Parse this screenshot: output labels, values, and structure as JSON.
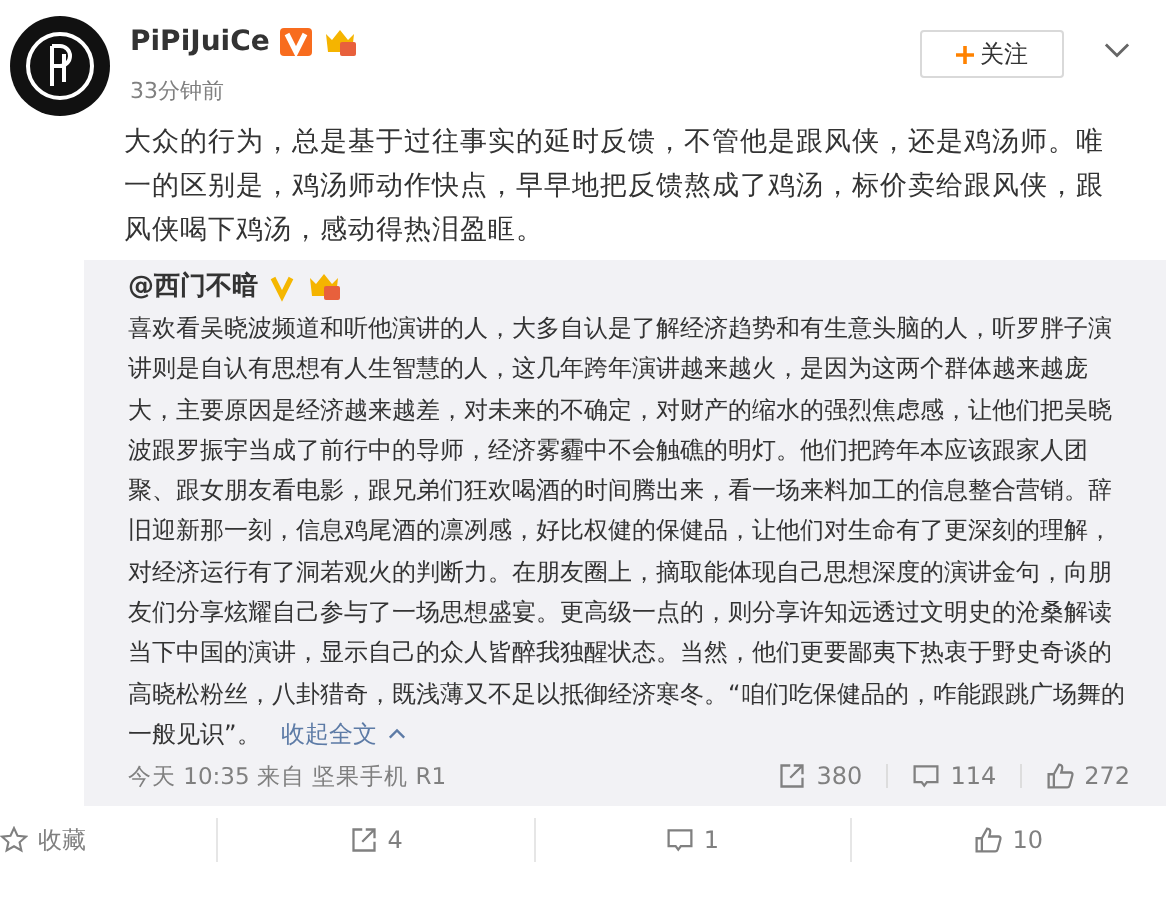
{
  "post": {
    "author": "PiPiJuiCe",
    "verified": true,
    "time": "33分钟前",
    "follow_button": "关注",
    "text": "大众的行为，总是基于过往事实的延时反馈，不管他是跟风侠，还是鸡汤师。唯一的区别是，鸡汤师动作快点，早早地把反馈熬成了鸡汤，标价卖给跟风侠，跟风侠喝下鸡汤，感动得热泪盈眶。"
  },
  "repost": {
    "author": "@西门不暗",
    "verified": true,
    "text": "喜欢看吴晓波频道和听他演讲的人，大多自认是了解经济趋势和有生意头脑的人，听罗胖子演讲则是自认有思想有人生智慧的人，这几年跨年演讲越来越火，是因为这两个群体越来越庞大，主要原因是经济越来越差，对未来的不确定，对财产的缩水的强烈焦虑感，让他们把吴晓波跟罗振宇当成了前行中的导师，经济雾霾中不会触礁的明灯。他们把跨年本应该跟家人团聚、跟女朋友看电影，跟兄弟们狂欢喝酒的时间腾出来，看一场来料加工的信息整合营销。辞旧迎新那一刻，信息鸡尾酒的凛冽感，好比权健的保健品，让他们对生命有了更深刻的理解，对经济运行有了洞若观火的判断力。在朋友圈上，摘取能体现自己思想深度的演讲金句，向朋友们分享炫耀自己参与了一场思想盛宴。更高级一点的，则分享许知远透过文明史的沧桑解读当下中国的演讲，显示自己的众人皆醉我独醒状态。当然，他们更要鄙夷下热衷于野史奇谈的高晓松粉丝，八卦猎奇，既浅薄又不足以抵御经济寒冬。“咱们吃保健品的，咋能跟跳广场舞的一般见识”。",
    "collapse_link": "收起全文",
    "meta": "今天 10:35 来自 坚果手机 R1",
    "stats": [
      {
        "kind": "repost",
        "count": "380"
      },
      {
        "kind": "comment",
        "count": "114"
      },
      {
        "kind": "like",
        "count": "272"
      }
    ]
  },
  "actions": [
    {
      "kind": "favorite",
      "label": "收藏"
    },
    {
      "kind": "repost",
      "label": "4"
    },
    {
      "kind": "comment",
      "label": "1"
    },
    {
      "kind": "like",
      "label": "10"
    }
  ]
}
